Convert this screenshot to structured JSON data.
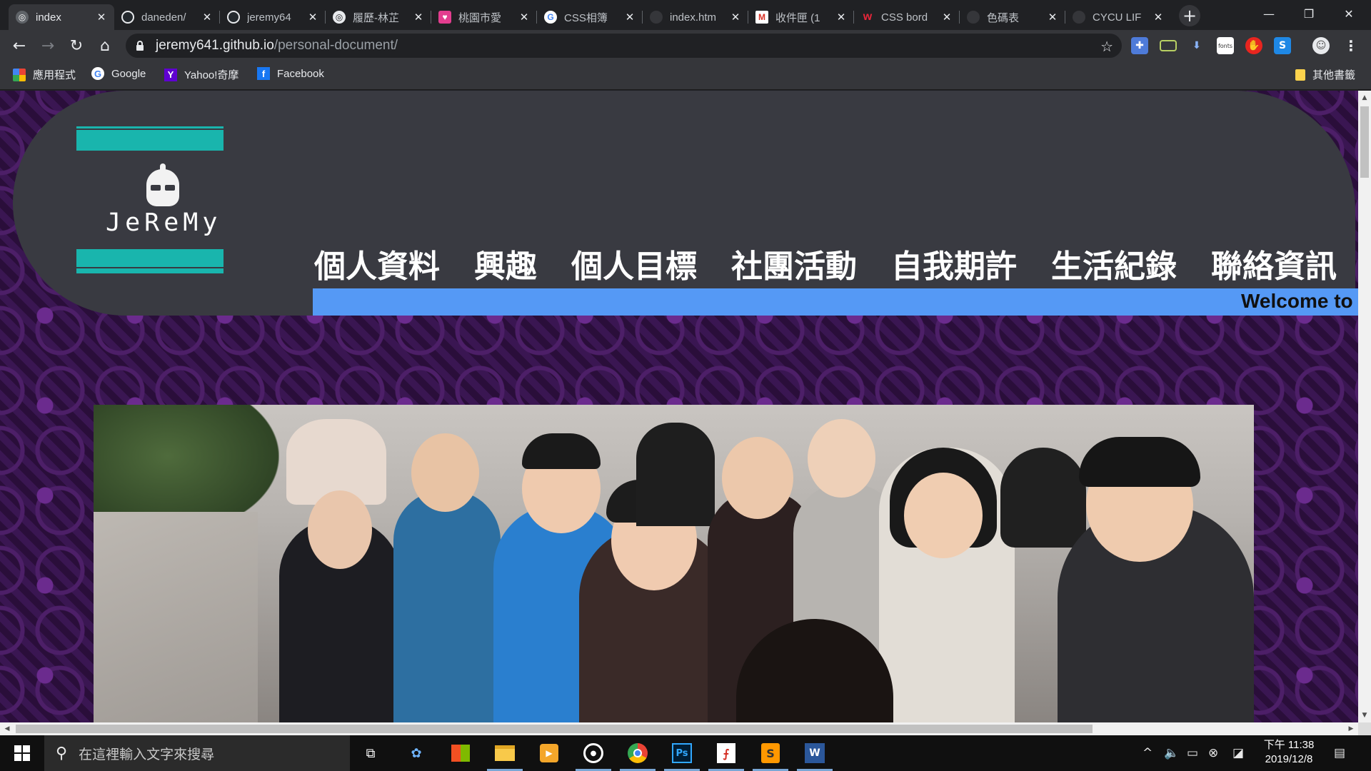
{
  "browser": {
    "tabs": [
      {
        "label": "index",
        "icon": "globe-icon",
        "active": true
      },
      {
        "label": "daneden/",
        "icon": "github-icon"
      },
      {
        "label": "jeremy64",
        "icon": "github-icon"
      },
      {
        "label": "履歷-林芷",
        "icon": "globe-icon"
      },
      {
        "label": "桃園市愛",
        "icon": "heart-icon"
      },
      {
        "label": "CSS相簿",
        "icon": "google-icon"
      },
      {
        "label": "index.htm",
        "icon": "globe-icon"
      },
      {
        "label": "收件匣 (1",
        "icon": "gmail-icon"
      },
      {
        "label": "CSS bord",
        "icon": "w3-icon"
      },
      {
        "label": "色碼表",
        "icon": "globe-icon"
      },
      {
        "label": "CYCU LIF",
        "icon": "globe-icon"
      }
    ],
    "url_host": "jeremy641.github.io",
    "url_path": "/personal-document/",
    "bookmarks": [
      {
        "label": "應用程式",
        "icon": "apps-icon"
      },
      {
        "label": "Google",
        "icon": "google-icon"
      },
      {
        "label": "Yahoo!奇摩",
        "icon": "yahoo-icon"
      },
      {
        "label": "Facebook",
        "icon": "facebook-icon"
      }
    ],
    "other_bookmarks": "其他書籤",
    "extensions": [
      "puzzle-extension-icon",
      "monitor-extension-icon",
      "download-extension-icon",
      "fonts-extension-icon",
      "adblock-extension-icon",
      "s-extension-icon",
      "profile-avatar"
    ],
    "extension_font_label": "fonts"
  },
  "site": {
    "logo_text": "JeReMy",
    "menu": [
      "個人資料",
      "興趣",
      "個人目標",
      "社團活動",
      "自我期許",
      "生活紀錄",
      "聯絡資訊"
    ],
    "marquee": "Welcome to",
    "colors": {
      "header": "#393a41",
      "teal": "#19b5ad",
      "band": "#5599f5",
      "background": "#2e1241"
    }
  },
  "taskbar": {
    "search_placeholder": "在這裡輸入文字來搜尋",
    "apps": [
      "task-view-icon",
      "paint-icon",
      "store-icon",
      "file-explorer-icon",
      "media-player-icon",
      "groove-icon",
      "chrome-icon",
      "photoshop-icon",
      "acrobat-icon",
      "sublime-icon",
      "word-icon"
    ],
    "photoshop_label": "Ps",
    "word_label": "W",
    "clock_time": "下午 11:38",
    "clock_date": "2019/12/8"
  }
}
